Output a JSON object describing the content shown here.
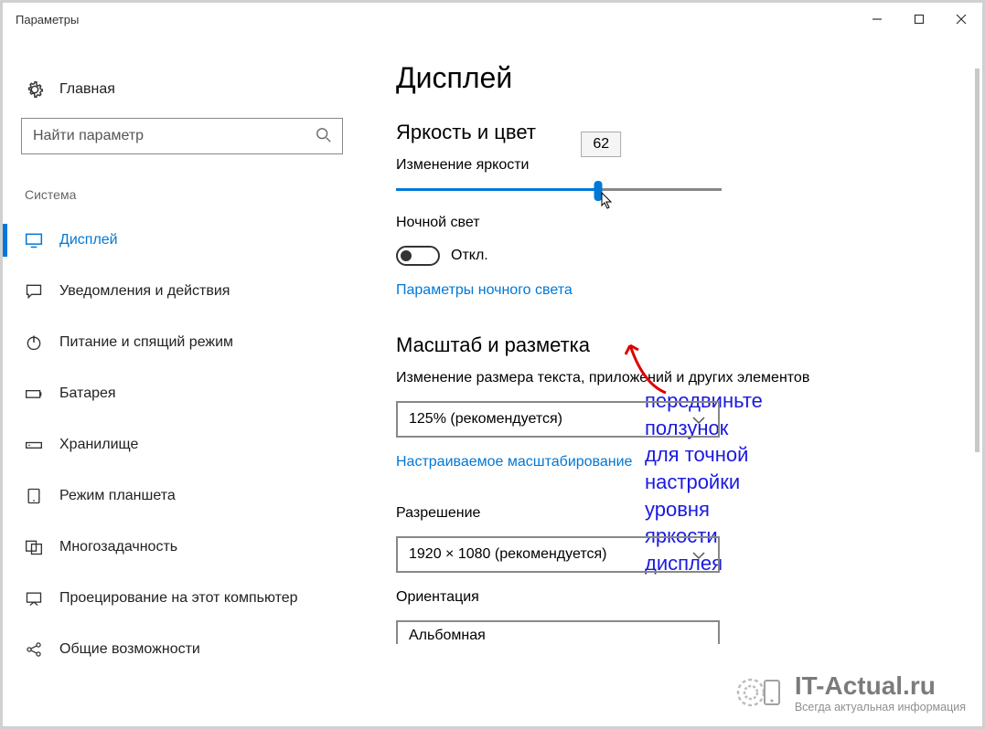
{
  "window": {
    "title": "Параметры"
  },
  "sidebar": {
    "home": "Главная",
    "search_placeholder": "Найти параметр",
    "section": "Система",
    "items": [
      {
        "label": "Дисплей"
      },
      {
        "label": "Уведомления и действия"
      },
      {
        "label": "Питание и спящий режим"
      },
      {
        "label": "Батарея"
      },
      {
        "label": "Хранилище"
      },
      {
        "label": "Режим планшета"
      },
      {
        "label": "Многозадачность"
      },
      {
        "label": "Проецирование на этот компьютер"
      },
      {
        "label": "Общие возможности"
      }
    ]
  },
  "main": {
    "title": "Дисплей",
    "brightness": {
      "section": "Яркость и цвет",
      "label": "Изменение яркости",
      "value": "62",
      "percent": 62
    },
    "nightlight": {
      "label": "Ночной свет",
      "state": "Откл.",
      "settings_link": "Параметры ночного света"
    },
    "scale": {
      "section": "Масштаб и разметка",
      "label": "Изменение размера текста, приложений и других элементов",
      "value": "125% (рекомендуется)",
      "custom_link": "Настраиваемое масштабирование"
    },
    "resolution": {
      "label": "Разрешение",
      "value": "1920 × 1080 (рекомендуется)"
    },
    "orientation": {
      "label": "Ориентация",
      "value": "Альбомная"
    }
  },
  "annotation": {
    "line1": "передвиньте ползунок",
    "line2": "для точной настройки",
    "line3": "уровня яркости дисплея"
  },
  "watermark": {
    "brand": "IT-Actual.ru",
    "tagline": "Всегда актуальная информация"
  }
}
